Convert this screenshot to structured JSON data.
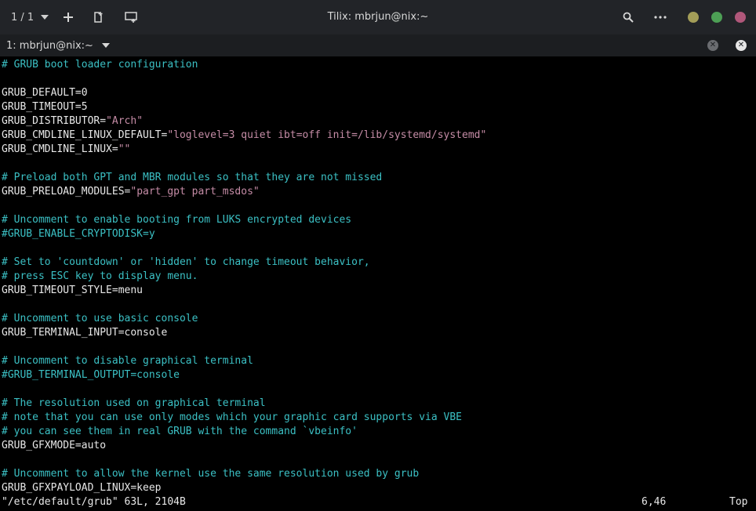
{
  "titlebar": {
    "session_label": "1 / 1",
    "title": "Tilix: mbrjun@nix:~",
    "icons": [
      "chevron-down-icon",
      "plus-icon",
      "add-right-icon",
      "add-down-icon",
      "search-icon",
      "more-icon"
    ],
    "window_control_colors": {
      "minimize": "#a39d58",
      "maximize": "#4d9f55",
      "close": "#b0577a"
    }
  },
  "tabbar": {
    "tab_label": "1: mbrjun@nix:~"
  },
  "editor": {
    "lines": [
      [
        {
          "t": "# GRUB boot loader configuration",
          "c": "comment"
        }
      ],
      [],
      [
        {
          "t": "GRUB_DEFAULT=0",
          "c": "plain"
        }
      ],
      [
        {
          "t": "GRUB_TIMEOUT=5",
          "c": "plain"
        }
      ],
      [
        {
          "t": "GRUB_DISTRIBUTOR=",
          "c": "plain"
        },
        {
          "t": "\"Arch\"",
          "c": "str"
        }
      ],
      [
        {
          "t": "GRUB_CMDLINE_LINUX_DEFAULT=",
          "c": "plain"
        },
        {
          "t": "\"loglevel=3 quiet ibt=off init=/lib/systemd/systemd\"",
          "c": "str"
        }
      ],
      [
        {
          "t": "GRUB_CMDLINE_LINUX=",
          "c": "plain"
        },
        {
          "t": "\"\"",
          "c": "str"
        }
      ],
      [],
      [
        {
          "t": "# Preload both GPT and MBR modules so that they are not missed",
          "c": "comment"
        }
      ],
      [
        {
          "t": "GRUB_PRELOAD_MODULES=",
          "c": "plain"
        },
        {
          "t": "\"part_gpt part_msdos\"",
          "c": "str"
        }
      ],
      [],
      [
        {
          "t": "# Uncomment to enable booting from LUKS encrypted devices",
          "c": "comment"
        }
      ],
      [
        {
          "t": "#GRUB_ENABLE_CRYPTODISK=y",
          "c": "comment"
        }
      ],
      [],
      [
        {
          "t": "# Set to 'countdown' or 'hidden' to change timeout behavior,",
          "c": "comment"
        }
      ],
      [
        {
          "t": "# press ESC key to display menu.",
          "c": "comment"
        }
      ],
      [
        {
          "t": "GRUB_TIMEOUT_STYLE=menu",
          "c": "plain"
        }
      ],
      [],
      [
        {
          "t": "# Uncomment to use basic console",
          "c": "comment"
        }
      ],
      [
        {
          "t": "GRUB_TERMINAL_INPUT=console",
          "c": "plain"
        }
      ],
      [],
      [
        {
          "t": "# Uncomment to disable graphical terminal",
          "c": "comment"
        }
      ],
      [
        {
          "t": "#GRUB_TERMINAL_OUTPUT=console",
          "c": "comment"
        }
      ],
      [],
      [
        {
          "t": "# The resolution used on graphical terminal",
          "c": "comment"
        }
      ],
      [
        {
          "t": "# note that you can use only modes which your graphic card supports via VBE",
          "c": "comment"
        }
      ],
      [
        {
          "t": "# you can see them in real GRUB with the command `vbeinfo'",
          "c": "comment"
        }
      ],
      [
        {
          "t": "GRUB_GFXMODE=auto",
          "c": "plain"
        }
      ],
      [],
      [
        {
          "t": "# Uncomment to allow the kernel use the same resolution used by grub",
          "c": "comment"
        }
      ],
      [
        {
          "t": "GRUB_GFXPAYLOAD_LINUX=keep",
          "c": "plain"
        }
      ]
    ]
  },
  "statusline": {
    "file_info": "\"/etc/default/grub\" 63L, 2104B",
    "cursor_pos": "6,46",
    "scroll_pos": "Top"
  }
}
